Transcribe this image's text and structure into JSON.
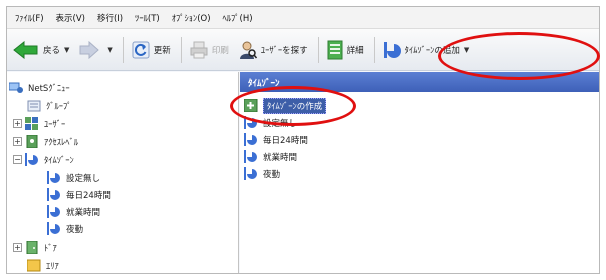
{
  "menu": [
    "ﾌｧｲﾙ(F)",
    "表示(V)",
    "移行(I)",
    "ﾂｰﾙ(T)",
    "ｵﾌﾟｼｮﾝ(O)",
    "ﾍﾙﾌﾟ(H)"
  ],
  "toolbar": {
    "back_label": "戻る",
    "refresh_label": "更新",
    "print_label": "印刷",
    "find_user_label": "ﾕｰｻﾞｰを探す",
    "properties_label": "詳細",
    "add_timezone_label": "ﾀｲﾑｿﾞｰﾝの追加"
  },
  "tree": {
    "root": "NetSｸﾞﾆｭｰ",
    "items": [
      "ｸﾞﾙｰﾌﾟ",
      "ﾕｰｻﾞｰ",
      "ｱｸｾｽﾚﾍﾞﾙ",
      "ﾀｲﾑｿﾞｰﾝ",
      "設定無し",
      "毎日24時間",
      "就業時間",
      "夜勤",
      "ﾄﾞｱ",
      "ｴﾘｱ"
    ]
  },
  "group_header": "ﾀｲﾑｿﾞｰﾝ",
  "list_items": [
    "ﾀｲﾑｿﾞｰﾝの作成",
    "設定無し",
    "毎日24時間",
    "就業時間",
    "夜勤"
  ],
  "colors": {
    "annotation": "#e01010",
    "group_header": "#4a6cc4",
    "selection": "#3d5ea8"
  }
}
